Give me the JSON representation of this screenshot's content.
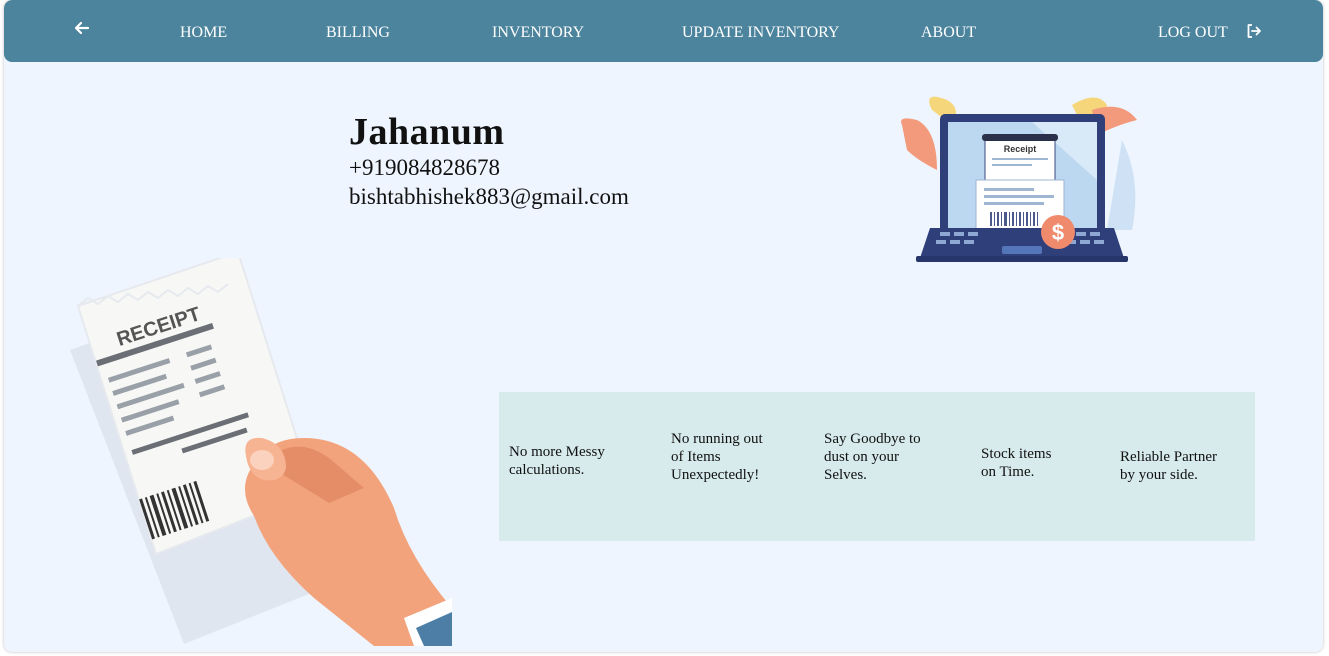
{
  "nav": {
    "back_icon": "arrow-left-icon",
    "items": [
      "HOME",
      "BILLING",
      "INVENTORY",
      "UPDATE INVENTORY",
      "ABOUT"
    ],
    "logout_label": "LOG OUT",
    "logout_icon": "sign-out-icon",
    "color": "#4c849d"
  },
  "profile": {
    "name": "Jahanum",
    "phone": "+919084828678",
    "email": "bishtabhishek883@gmail.com"
  },
  "illustrations": {
    "laptop_receipt_label": "Receipt",
    "hand_receipt_label": "RECEIPT"
  },
  "features": [
    {
      "line1": "No more Messy",
      "line2": "calculations.",
      "line3": ""
    },
    {
      "line1": "No running out",
      "line2": "of Items",
      "line3": "Unexpectedly!"
    },
    {
      "line1": "Say Goodbye to",
      "line2": "dust on your",
      "line3": "Selves."
    },
    {
      "line1": "Stock items",
      "line2": "on Time.",
      "line3": ""
    },
    {
      "line1": "Reliable Partner",
      "line2": "by your side.",
      "line3": ""
    }
  ],
  "colors": {
    "page_bg": "#eef5fe",
    "features_bg": "#d7ebed"
  }
}
